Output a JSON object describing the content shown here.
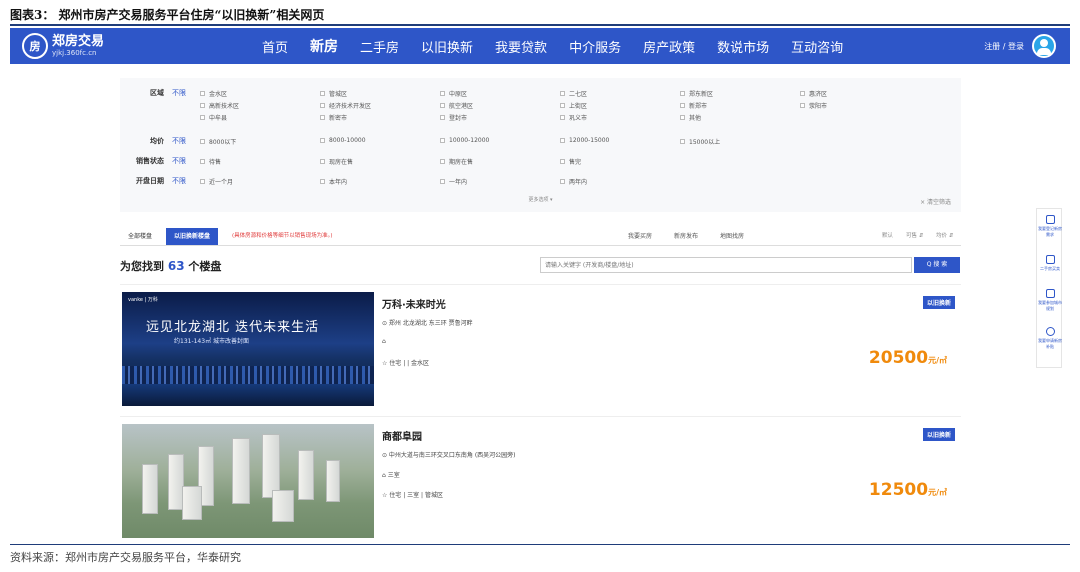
{
  "report": {
    "title": "图表3： 郑州市房产交易服务平台住房“以旧换新”相关网页",
    "source": "资料来源：郑州市房产交易服务平台，华泰研究"
  },
  "nav": {
    "logo_mark": "房",
    "logo_name": "郑房交易",
    "logo_url": "yjkj.360fc.cn",
    "items": [
      "首页",
      "新房",
      "二手房",
      "以旧换新",
      "我要贷款",
      "中介服务",
      "房产政策",
      "数说市场",
      "互动咨询"
    ],
    "active": "新房",
    "login": "注册 / 登录",
    "colors": {
      "bar": "#2e56c8",
      "accent": "#f08a0c"
    }
  },
  "filters": {
    "unlimited": "不限",
    "district": {
      "label": "区域",
      "options": [
        "金水区",
        "管城区",
        "中原区",
        "二七区",
        "郑东新区",
        "惠济区",
        "高新技术区",
        "经济技术开发区",
        "航空港区",
        "上街区",
        "新郑市",
        "荥阳市",
        "中牟县",
        "新密市",
        "登封市",
        "巩义市",
        "其他"
      ]
    },
    "price": {
      "label": "均价",
      "options": [
        "8000以下",
        "8000-10000",
        "10000-12000",
        "12000-15000",
        "15000以上"
      ]
    },
    "status": {
      "label": "销售状态",
      "options": [
        "待售",
        "现房在售",
        "期房在售",
        "售完"
      ]
    },
    "opening": {
      "label": "开盘日期",
      "options": [
        "近一个月",
        "本年内",
        "一年内",
        "两年内"
      ]
    },
    "more": "更多选项 ▾",
    "clear": "× 清空筛选"
  },
  "tabs": {
    "all": "全部楼盘",
    "trade_in": "以旧换新楼盘",
    "note": "(具体房源和价格等细节以销售现场为准。)",
    "links": [
      "我要买房",
      "新房发布",
      "地图找房"
    ],
    "sort": [
      "默认",
      "可售 ⇵",
      "均价 ⇵"
    ]
  },
  "results": {
    "prefix": "为您找到",
    "count": "63",
    "suffix": "个楼盘",
    "search_placeholder": "请输入关键字 (开发商/楼盘/地址)",
    "search_button": "Q 搜 索"
  },
  "listings": [
    {
      "name": "万科·未来时光",
      "address": "⊙ 郑州 北龙湖北 东三环 贾鲁河畔",
      "tag_line": "⌂",
      "type_line": "☆ 住宅 | | 金水区",
      "badge": "以旧换新",
      "price": "20500",
      "unit": "元/㎡",
      "image_headline": "远见北龙湖北  迭代未来生活",
      "image_sub": "约131-143㎡ 城市改善封面",
      "image_brand": "vanke | 万科"
    },
    {
      "name": "商都阜园",
      "address": "⊙ 中州大道与南三环交叉口东南角 (西吴河公园旁)",
      "tag_line": "⌂ 三室",
      "type_line": "☆ 住宅 | 三室 | 管城区",
      "badge": "以旧换新",
      "price": "12500",
      "unit": "元/㎡"
    }
  ],
  "side_toolbar": [
    "我要登记新房需求",
    "二手房买卖",
    "我要参加城市规划",
    "我要申请新房补贴"
  ]
}
